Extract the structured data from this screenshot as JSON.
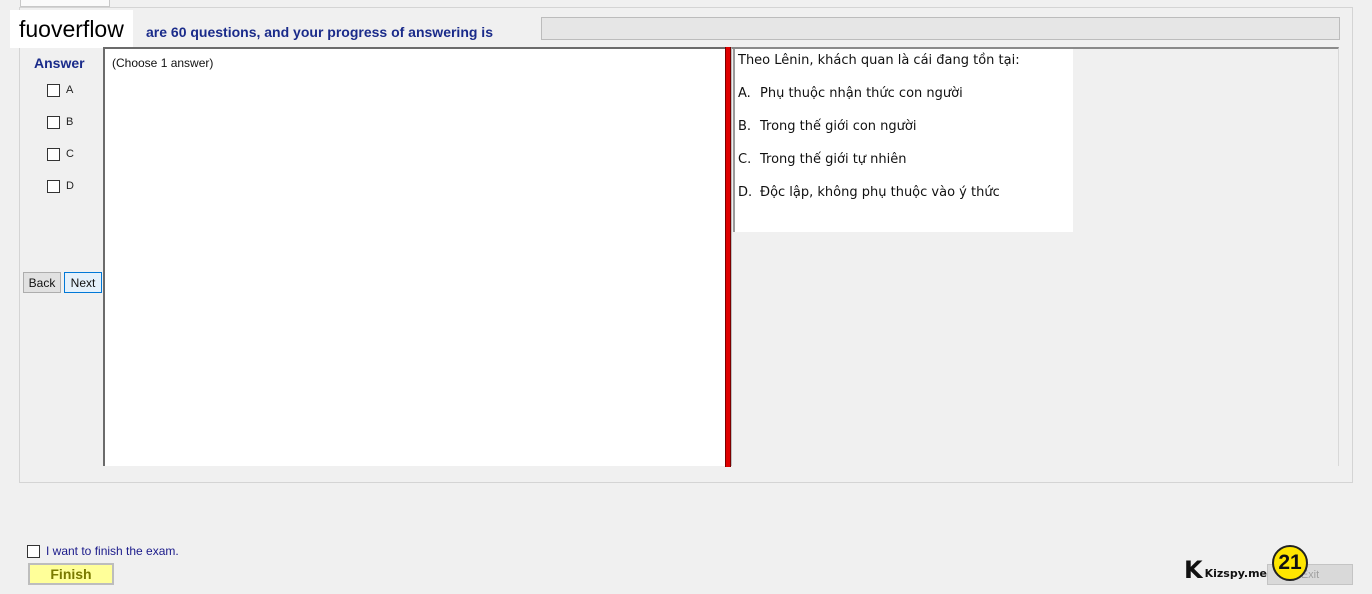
{
  "brand": {
    "text": "fuoverflow"
  },
  "header": {
    "text": "are 60 questions, and your progress of answering is"
  },
  "progress": {
    "value_percent": 0,
    "fill_color": "#06b025"
  },
  "answer": {
    "label": "Answer",
    "options": [
      {
        "label": "A"
      },
      {
        "label": "B"
      },
      {
        "label": "C"
      },
      {
        "label": "D"
      }
    ]
  },
  "navigation": {
    "back_label": "Back",
    "next_label": "Next"
  },
  "answer_panel": {
    "hint": "(Choose 1 answer)"
  },
  "question": {
    "title": "Theo Lênin, khách quan là cái đang tồn tại:",
    "choices": [
      {
        "letter": "A.",
        "text": "Phụ thuộc nhận thức con người"
      },
      {
        "letter": "B.",
        "text": "Trong thế giới con người"
      },
      {
        "letter": "C.",
        "text": "Trong thế giới tự nhiên"
      },
      {
        "letter": "D.",
        "text": "Độc lập, không phụ thuộc vào ý thức"
      }
    ]
  },
  "footer": {
    "finish_checkbox_label": "I want to finish the exam.",
    "finish_button_label": "Finish",
    "exit_button_label": "Exit",
    "logo_letter": "K",
    "logo_text": "Kizspy.me",
    "badge_number": "21"
  },
  "colors": {
    "accent_blue": "#1a2b8a",
    "divider_red": "#e00000",
    "finish_yellow": "#ffff99",
    "badge_yellow": "#ffe600"
  }
}
